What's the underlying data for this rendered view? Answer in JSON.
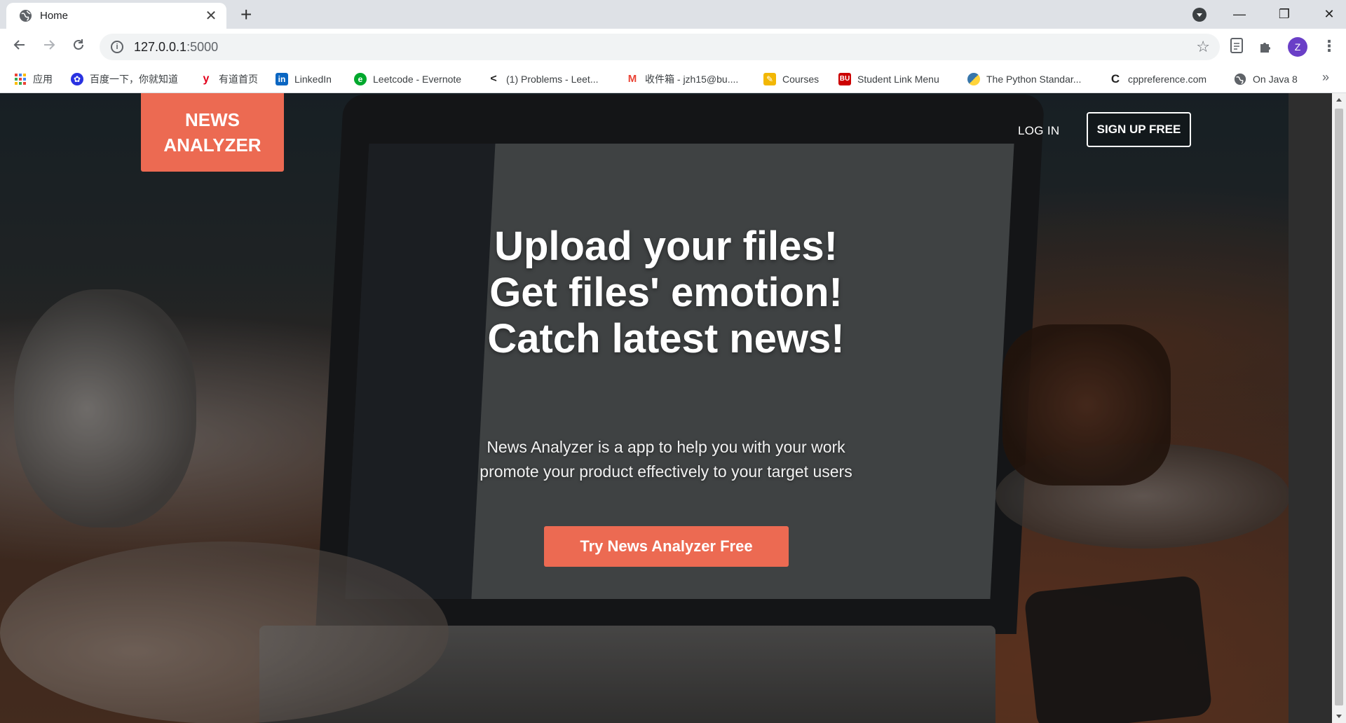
{
  "browser": {
    "tab": {
      "title": "Home",
      "icon": "globe-icon"
    },
    "new_tab_icon": "plus-icon",
    "url_host": "127.0.0.1",
    "url_port": ":5000",
    "profile_initial": "Z",
    "window_controls": {
      "minimize": "—",
      "maximize": "❐",
      "close": "✕"
    }
  },
  "bookmarks": [
    {
      "label": "应用",
      "icon": "apps-grid-icon",
      "color": "#4285f4"
    },
    {
      "label": "百度一下，你就知道",
      "icon": "baidu-paw-icon",
      "color": "#2932e1"
    },
    {
      "label": "有道首页",
      "icon": "youdao-icon",
      "color": "#e3001b"
    },
    {
      "label": "LinkedIn",
      "icon": "linkedin-icon",
      "color": "#0a66c2"
    },
    {
      "label": "Leetcode - Evernote",
      "icon": "evernote-icon",
      "color": "#00a82d"
    },
    {
      "label": "(1) Problems - Leet...",
      "icon": "leetcode-icon",
      "color": "#222222"
    },
    {
      "label": "收件箱 - jzh15@bu....",
      "icon": "gmail-icon",
      "color": "#ea4335"
    },
    {
      "label": "Courses",
      "icon": "courses-icon",
      "color": "#f2b705"
    },
    {
      "label": "Student Link Menu",
      "icon": "bu-icon",
      "color": "#cc0000"
    },
    {
      "label": "The Python Standar...",
      "icon": "python-icon",
      "color": "#3776ab"
    },
    {
      "label": "cppreference.com",
      "icon": "cppreference-icon",
      "color": "#222222"
    },
    {
      "label": "On Java 8",
      "icon": "globe-icon",
      "color": "#5f6368"
    }
  ],
  "site": {
    "logo_line1": "NEWS",
    "logo_line2": "ANALYZER",
    "login_label": "LOG IN",
    "signup_label": "SIGN UP FREE",
    "headline": [
      "Upload your files!",
      "Get files' emotion!",
      "Catch latest news!"
    ],
    "subtitle": [
      "News Analyzer is a app to help you with your work",
      "promote your product effectively to your target users"
    ],
    "cta_label": "Try News Analyzer Free",
    "accent_color": "#ec6a52"
  }
}
